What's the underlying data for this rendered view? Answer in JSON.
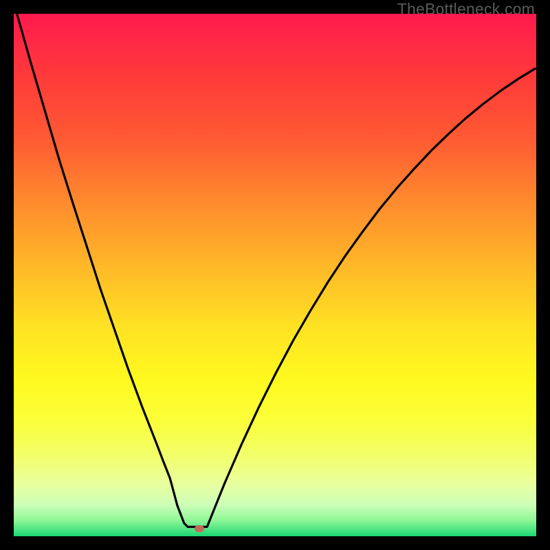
{
  "brand": "TheBottleneck.com",
  "chart_data": {
    "type": "line",
    "title": "",
    "xlabel": "",
    "ylabel": "",
    "xlim": [
      0,
      1
    ],
    "ylim": [
      0,
      1
    ],
    "gradient_stops": [
      {
        "pos": 0.0,
        "color": "#ff1a4d"
      },
      {
        "pos": 0.6,
        "color": "#ffe223"
      },
      {
        "pos": 1.0,
        "color": "#1bd872"
      }
    ],
    "series": [
      {
        "name": "left-branch",
        "x": [
          0.006,
          0.033,
          0.06,
          0.086,
          0.113,
          0.14,
          0.166,
          0.193,
          0.219,
          0.246,
          0.273,
          0.286,
          0.299,
          0.313,
          0.326,
          0.333
        ],
        "values": [
          1.0,
          0.905,
          0.813,
          0.724,
          0.638,
          0.554,
          0.473,
          0.395,
          0.32,
          0.247,
          0.178,
          0.144,
          0.111,
          0.059,
          0.025,
          0.018
        ]
      },
      {
        "name": "valley-floor",
        "x": [
          0.333,
          0.34,
          0.348,
          0.355,
          0.363,
          0.37
        ],
        "values": [
          0.018,
          0.018,
          0.018,
          0.018,
          0.018,
          0.018
        ]
      },
      {
        "name": "right-branch",
        "x": [
          0.37,
          0.403,
          0.436,
          0.469,
          0.502,
          0.535,
          0.568,
          0.601,
          0.634,
          0.667,
          0.7,
          0.733,
          0.766,
          0.799,
          0.832,
          0.865,
          0.898,
          0.931,
          0.965,
          0.998
        ],
        "values": [
          0.018,
          0.1,
          0.176,
          0.247,
          0.313,
          0.375,
          0.432,
          0.486,
          0.536,
          0.582,
          0.626,
          0.666,
          0.703,
          0.738,
          0.77,
          0.8,
          0.827,
          0.852,
          0.875,
          0.895
        ]
      }
    ],
    "marker": {
      "x": 0.355,
      "y": 0.015
    },
    "colors": {
      "curve": "#000000",
      "marker": "#c56a5b",
      "frame": "#000000"
    }
  }
}
